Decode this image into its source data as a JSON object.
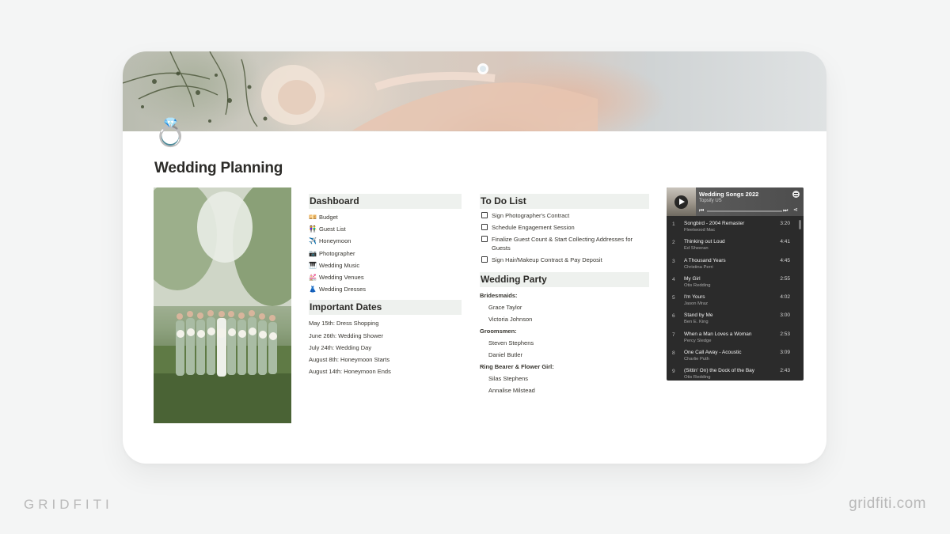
{
  "page": {
    "icon": "💍",
    "icon_name": "ring-icon",
    "title": "Wedding Planning"
  },
  "dashboard": {
    "heading": "Dashboard",
    "items": [
      {
        "icon": "💴",
        "icon_name": "money-icon",
        "label": "Budget"
      },
      {
        "icon": "👫",
        "icon_name": "couple-icon",
        "label": "Guest List"
      },
      {
        "icon": "✈️",
        "icon_name": "airplane-icon",
        "label": "Honeymoon"
      },
      {
        "icon": "📷",
        "icon_name": "camera-icon",
        "label": "Photographer"
      },
      {
        "icon": "🎹",
        "icon_name": "piano-icon",
        "label": "Wedding Music"
      },
      {
        "icon": "💒",
        "icon_name": "chapel-icon",
        "label": "Wedding Venues"
      },
      {
        "icon": "👗",
        "icon_name": "dress-icon",
        "label": "Wedding Dresses"
      }
    ]
  },
  "important_dates": {
    "heading": "Important Dates",
    "items": [
      "May 15th: Dress Shopping",
      "June 26th: Wedding Shower",
      "July 24th: Wedding Day",
      "August 8th: Honeymoon Starts",
      "August 14th: Honeymoon Ends"
    ]
  },
  "todo": {
    "heading": "To Do List",
    "items": [
      "Sign Photographer's Contract",
      "Schedule Engagement Session",
      "Finalize Guest Count & Start Collecting Addresses for Guests",
      "Sign Hair/Makeup Contract & Pay Deposit"
    ]
  },
  "wedding_party": {
    "heading": "Wedding Party",
    "groups": [
      {
        "label": "Bridesmaids:",
        "names": [
          "Grace Taylor",
          "Victoria Johnson"
        ]
      },
      {
        "label": "Groomsmen:",
        "names": [
          "Steven Stephens",
          "Daniel Butler"
        ]
      },
      {
        "label": "Ring Bearer & Flower Girl:",
        "names": [
          "Silas Stephens",
          "Annalise Milstead"
        ]
      }
    ]
  },
  "player": {
    "playlist_title": "Wedding Songs 2022",
    "owner": "Topsify US",
    "progress": 0.0,
    "tracks": [
      {
        "n": "1",
        "title": "Songbird - 2004 Remaster",
        "artist": "Fleetwood Mac",
        "duration": "3:20"
      },
      {
        "n": "2",
        "title": "Thinking out Loud",
        "artist": "Ed Sheeran",
        "duration": "4:41"
      },
      {
        "n": "3",
        "title": "A Thousand Years",
        "artist": "Christina Perri",
        "duration": "4:45"
      },
      {
        "n": "4",
        "title": "My Girl",
        "artist": "Otis Redding",
        "duration": "2:55"
      },
      {
        "n": "5",
        "title": "I'm Yours",
        "artist": "Jason Mraz",
        "duration": "4:02"
      },
      {
        "n": "6",
        "title": "Stand by Me",
        "artist": "Ben E. King",
        "duration": "3:00"
      },
      {
        "n": "7",
        "title": "When a Man Loves a Woman",
        "artist": "Percy Sledge",
        "duration": "2:53"
      },
      {
        "n": "8",
        "title": "One Call Away - Acoustic",
        "artist": "Charlie Puth",
        "duration": "3:09"
      },
      {
        "n": "9",
        "title": "(Sittin' On) the Dock of the Bay",
        "artist": "Otis Redding",
        "duration": "2:43"
      }
    ]
  },
  "branding": {
    "left": "GRIDFITI",
    "right": "gridfiti.com"
  },
  "colors": {
    "section_head_bg": "#eef1ee",
    "player_bg": "#2b2b2b",
    "page_bg": "#f4f5f5"
  }
}
